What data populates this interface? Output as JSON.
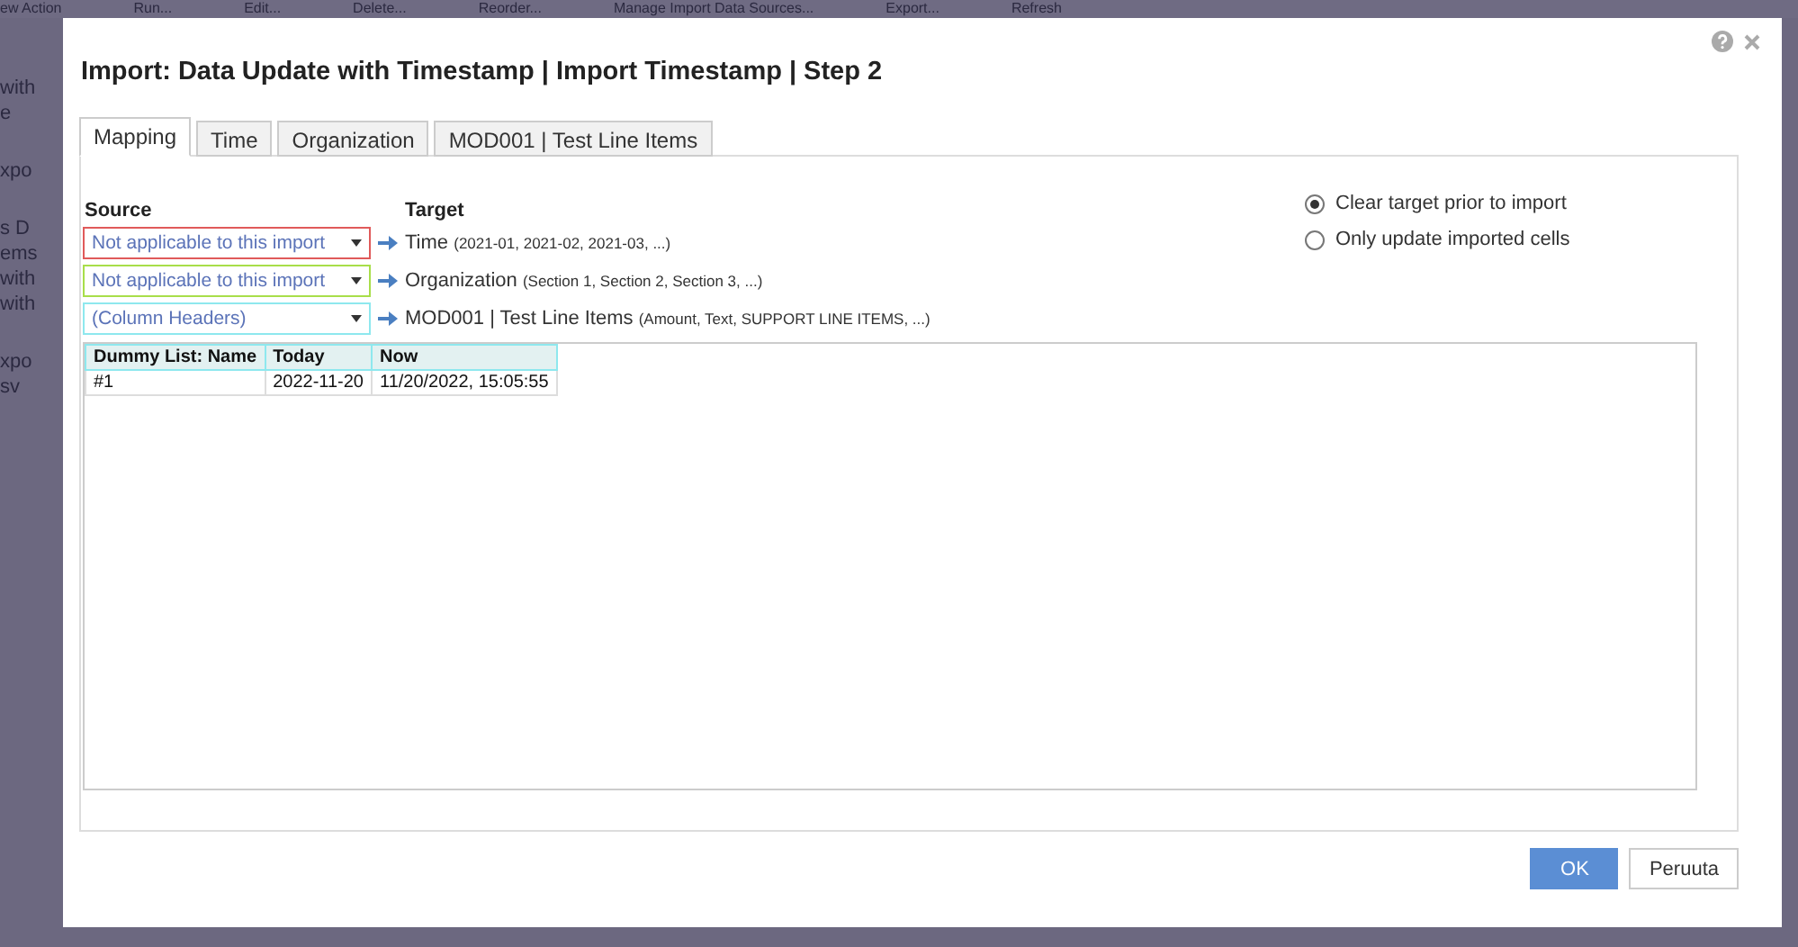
{
  "background": {
    "toolbar": [
      "ew Action",
      "Run...",
      "Edit...",
      "Delete...",
      "Reorder...",
      "Manage Import Data Sources...",
      "Export...",
      "Refresh"
    ],
    "row_groups": [
      [
        "with",
        "e"
      ],
      [
        "xpo"
      ],
      [
        "s D",
        "ems",
        "with",
        "with"
      ],
      [
        "xpo",
        "sv"
      ]
    ]
  },
  "dialog": {
    "title": "Import: Data Update with Timestamp | Import Timestamp | Step 2",
    "tabs": [
      {
        "label": "Mapping",
        "selected": true
      },
      {
        "label": "Time",
        "selected": false
      },
      {
        "label": "Organization",
        "selected": false
      },
      {
        "label": "MOD001 | Test Line Items",
        "selected": false
      }
    ],
    "source_header": "Source",
    "target_header": "Target",
    "mappings": [
      {
        "source": "Not applicable to this import",
        "color": "#e05a5a",
        "target": "Time",
        "examples": "(2021-01, 2021-02, 2021-03, ...)"
      },
      {
        "source": "Not applicable to this import",
        "color": "#a8de4a",
        "target": "Organization",
        "examples": "(Section 1, Section 2, Section 3, ...)"
      },
      {
        "source": "(Column Headers)",
        "color": "#8ee8ee",
        "target": "MOD001 | Test Line Items",
        "examples": "(Amount, Text, SUPPORT LINE ITEMS, ...)"
      }
    ],
    "options": [
      {
        "label": "Clear target prior to import",
        "selected": true
      },
      {
        "label": "Only update imported cells",
        "selected": false
      }
    ],
    "preview": {
      "columns": [
        "Dummy List: Name",
        "Today",
        "Now"
      ],
      "rows": [
        [
          "#1",
          "2022-11-20",
          "11/20/2022, 15:05:55"
        ]
      ]
    },
    "buttons": [
      {
        "label": "OK",
        "kind": "primary"
      },
      {
        "label": "Peruuta",
        "kind": "secondary"
      }
    ]
  }
}
